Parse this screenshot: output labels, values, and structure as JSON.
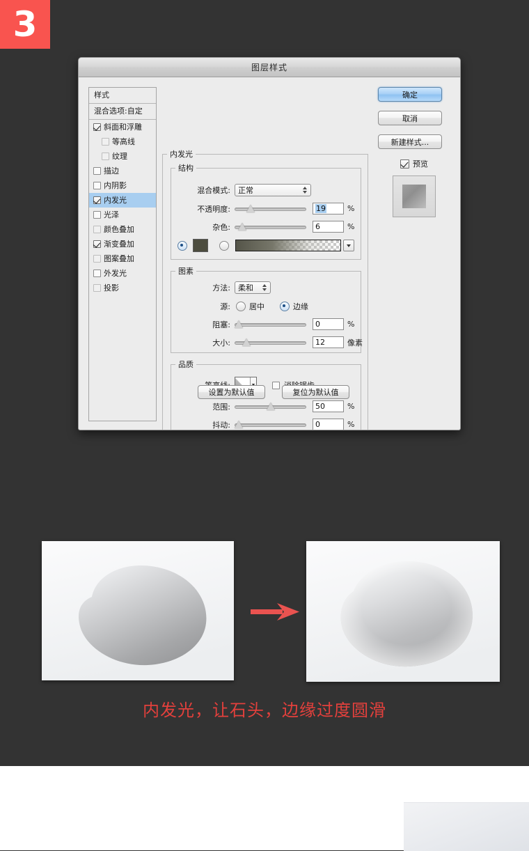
{
  "badge": {
    "number": "3",
    "color": "#f9544f"
  },
  "dialog": {
    "title": "图层样式",
    "style_list": {
      "header": "样式",
      "blending_options": "混合选项:自定",
      "items": [
        {
          "label": "斜面和浮雕",
          "checked": true,
          "indent": false,
          "selected": false,
          "dim": false
        },
        {
          "label": "等高线",
          "checked": false,
          "indent": true,
          "selected": false,
          "dim": true
        },
        {
          "label": "纹理",
          "checked": false,
          "indent": true,
          "selected": false,
          "dim": true
        },
        {
          "label": "描边",
          "checked": false,
          "indent": false,
          "selected": false,
          "dim": false
        },
        {
          "label": "内阴影",
          "checked": false,
          "indent": false,
          "selected": false,
          "dim": false
        },
        {
          "label": "内发光",
          "checked": true,
          "indent": false,
          "selected": true,
          "dim": false
        },
        {
          "label": "光泽",
          "checked": false,
          "indent": false,
          "selected": false,
          "dim": false
        },
        {
          "label": "颜色叠加",
          "checked": false,
          "indent": false,
          "selected": false,
          "dim": true
        },
        {
          "label": "渐变叠加",
          "checked": true,
          "indent": false,
          "selected": false,
          "dim": false
        },
        {
          "label": "图案叠加",
          "checked": false,
          "indent": false,
          "selected": false,
          "dim": true
        },
        {
          "label": "外发光",
          "checked": false,
          "indent": false,
          "selected": false,
          "dim": false
        },
        {
          "label": "投影",
          "checked": false,
          "indent": false,
          "selected": false,
          "dim": true
        }
      ]
    },
    "panel": {
      "group_title": "内发光",
      "structure": {
        "legend": "结构",
        "blend_mode_label": "混合模式:",
        "blend_mode_value": "正常",
        "opacity_label": "不透明度:",
        "opacity_value": "19",
        "opacity_unit": "%",
        "opacity_percent": 19,
        "noise_label": "杂色:",
        "noise_value": "6",
        "noise_unit": "%",
        "noise_percent": 6,
        "fill_type": "color",
        "color_hex": "#4c4c3e"
      },
      "elements": {
        "legend": "图素",
        "technique_label": "方法:",
        "technique_value": "柔和",
        "source_label": "源:",
        "source_center": "居中",
        "source_edge": "边缘",
        "source_selected": "edge",
        "choke_label": "阻塞:",
        "choke_value": "0",
        "choke_unit": "%",
        "choke_percent": 0,
        "size_label": "大小:",
        "size_value": "12",
        "size_unit": "像素",
        "size_percent": 12
      },
      "quality": {
        "legend": "品质",
        "contour_label": "等高线:",
        "antialias_label": "消除锯齿",
        "antialias_checked": false,
        "range_label": "范围:",
        "range_value": "50",
        "range_unit": "%",
        "range_percent": 50,
        "jitter_label": "抖动:",
        "jitter_value": "0",
        "jitter_unit": "%",
        "jitter_percent": 0
      },
      "set_default_label": "设置为默认值",
      "reset_default_label": "复位为默认值"
    },
    "buttons": {
      "ok": "确定",
      "cancel": "取消",
      "new_style": "新建样式...",
      "preview_label": "预览",
      "preview_checked": true
    }
  },
  "comparison": {
    "before_alt": "石头-内发光之前",
    "after_alt": "石头-内发光之后",
    "arrow": "arrow-right-icon",
    "arrow_color": "#ea5350"
  },
  "caption": {
    "text": "内发光，让石头，边缘过度圆滑",
    "color": "#e3403c"
  }
}
